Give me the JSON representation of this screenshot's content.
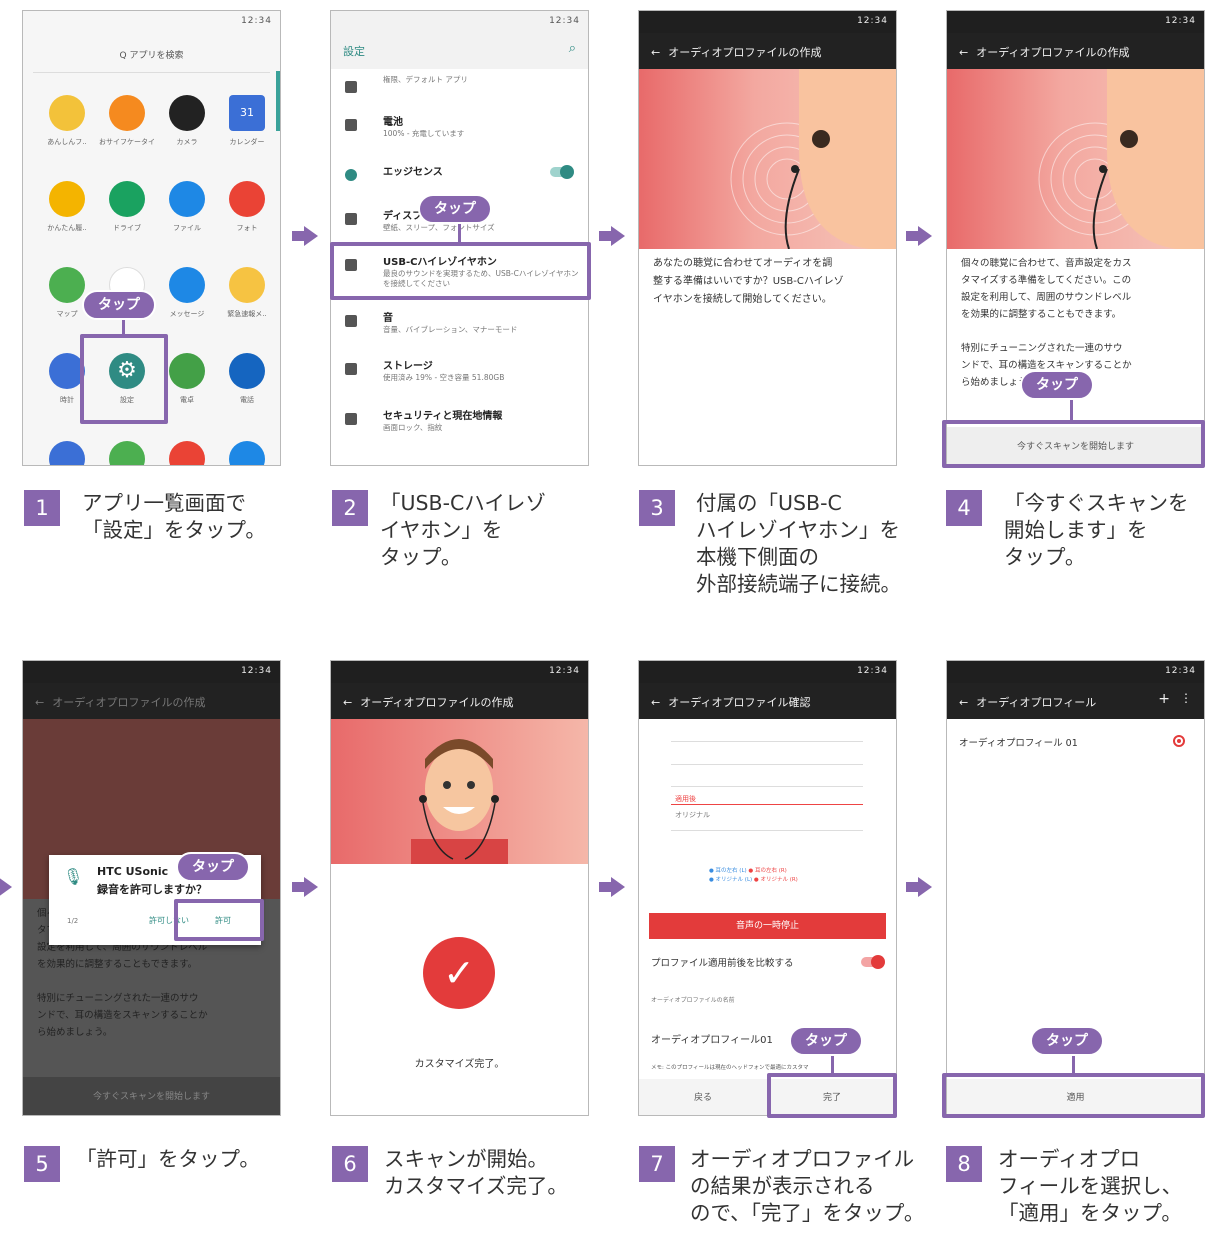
{
  "common": {
    "status_time": "12:34",
    "tap_label": "タップ"
  },
  "steps": [
    {
      "num": "1",
      "caption": "アプリ一覧画面で\n「設定」をタップ。"
    },
    {
      "num": "2",
      "caption": "「USB-Cハイレゾ\nイヤホン」を\nタップ。"
    },
    {
      "num": "3",
      "caption": "付属の「USB-C\nハイレゾイヤホン」を\n本機下側面の\n外部接続端子に接続。"
    },
    {
      "num": "4",
      "caption": "「今すぐスキャンを\n開始します」を\nタップ。"
    },
    {
      "num": "5",
      "caption": "「許可」をタップ。"
    },
    {
      "num": "6",
      "caption": "スキャンが開始。\nカスタマイズ完了。"
    },
    {
      "num": "7",
      "caption": "オーディオプロファイル\nの結果が表示される\nので、「完了」をタップ。"
    },
    {
      "num": "8",
      "caption": "オーディオプロ\nフィールを選択し、\n「適用」をタップ。"
    }
  ],
  "screen1": {
    "search_placeholder": "Q アプリを検索",
    "apps": [
      "あんしんフ..",
      "おサイフケータイ",
      "カメラ",
      "カレンダー",
      "かんたん履..",
      "ドライブ",
      "ファイル",
      "フォト",
      "マップ",
      "メール",
      "メッセージ",
      "緊急速報メ..",
      "時計",
      "設定",
      "電卓",
      "電話"
    ],
    "calendar_day": "31"
  },
  "screen2": {
    "title": "設定",
    "rows": [
      {
        "title": "",
        "sub": "権限、デフォルト アプリ"
      },
      {
        "title": "電池",
        "sub": "100% - 充電しています"
      },
      {
        "title": "エッジセンス",
        "sub": ""
      },
      {
        "title": "ディスプレイ",
        "sub": "壁紙、スリープ、フォントサイズ"
      },
      {
        "title": "USB-Cハイレゾイヤホン",
        "sub": "最良のサウンドを実現するため、USB-Cハイレゾイヤホンを接続してください"
      },
      {
        "title": "音",
        "sub": "音量、バイブレーション、マナーモード"
      },
      {
        "title": "ストレージ",
        "sub": "使用済み 19% - 空き容量 51.80GB"
      },
      {
        "title": "セキュリティと現在地情報",
        "sub": "画面ロック、指紋"
      }
    ]
  },
  "screen3": {
    "title": "オーディオプロファイルの作成",
    "body": "あなたの聴覚に合わせてオーディオを調\n整する準備はいいですか？USB-Cハイレゾ\nイヤホンを接続して開始してください。"
  },
  "screen4": {
    "title": "オーディオプロファイルの作成",
    "body": "個々の聴覚に合わせて、音声設定をカス\nタマイズする準備をしてください。この\n設定を利用して、周囲のサウンドレベル\nを効果的に調整することもできます。\n\n特別にチューニングされた一連のサウ\nンドで、耳の構造をスキャンすることか\nら始めましょう。",
    "button": "今すぐスキャンを開始します"
  },
  "screen5": {
    "title": "オーディオプロファイルの作成",
    "dialog_app": "HTC USonic",
    "dialog_question": "録音を許可しますか？",
    "dialog_counter": "1/2",
    "deny": "許可しない",
    "allow": "許可",
    "body": "個々の聴覚に合わせて、音声設定をカス\nタマイズする準備をしてください。この\n設定を利用して、周囲のサウンドレベル\nを効果的に調整することもできます。\n\n特別にチューニングされた一連のサウ\nンドで、耳の構造をスキャンすることか\nら始めましょう。",
    "button": "今すぐスキャンを開始します"
  },
  "screen6": {
    "title": "オーディオプロファイルの作成",
    "done_text": "カスタマイズ完了。"
  },
  "screen7": {
    "title": "オーディオプロファイル確認",
    "row_applied": "適用後",
    "row_original": "オリジナル",
    "legend": [
      "● 耳の左右 (L)",
      "● 耳の左右 (R)",
      "● オリジナル (L)",
      "● オリジナル (R)"
    ],
    "pause_button": "音声の一時停止",
    "compare_label": "プロファイル適用前後を比較する",
    "name_section": "オーディオプロファイルの名前",
    "name_value": "オーディオプロフィール01",
    "memo": "メモ: このプロフィールは現在のヘッドフォンで最適にカスタマ",
    "back": "戻る",
    "done": "完了"
  },
  "screen8": {
    "title": "オーディオプロフィール",
    "plus": "+",
    "more": "⋮",
    "item": "オーディオプロフィール 01",
    "apply": "適用"
  }
}
